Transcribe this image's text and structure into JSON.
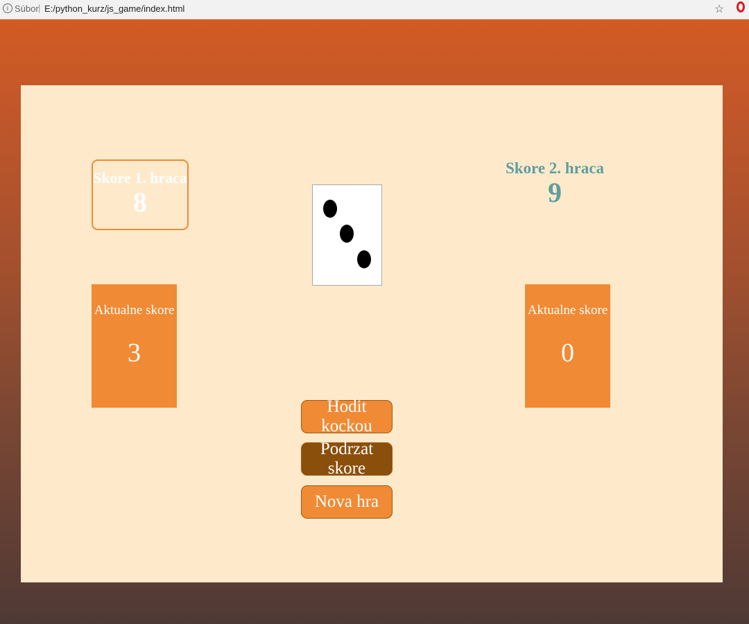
{
  "browser": {
    "url_prefix": "Súbor",
    "separator": "|",
    "url": "E:/python_kurz/js_game/index.html"
  },
  "game": {
    "player1": {
      "score_label": "Skore 1. hraca",
      "score": "8",
      "current_label": "Aktualne skore",
      "current": "3"
    },
    "player2": {
      "score_label": "Skore 2. hraca",
      "score": "9",
      "current_label": "Aktualne skore",
      "current": "0"
    },
    "die": {
      "value": 3
    },
    "buttons": {
      "roll": "Hodit kockou",
      "hold": "Podrzat skore",
      "new_game": "Nova hra"
    }
  },
  "colors": {
    "accent": "#f08a34",
    "hold_button": "#8b4f0c",
    "player2_text": "#5f9ea0",
    "panel": "#feeacb"
  }
}
